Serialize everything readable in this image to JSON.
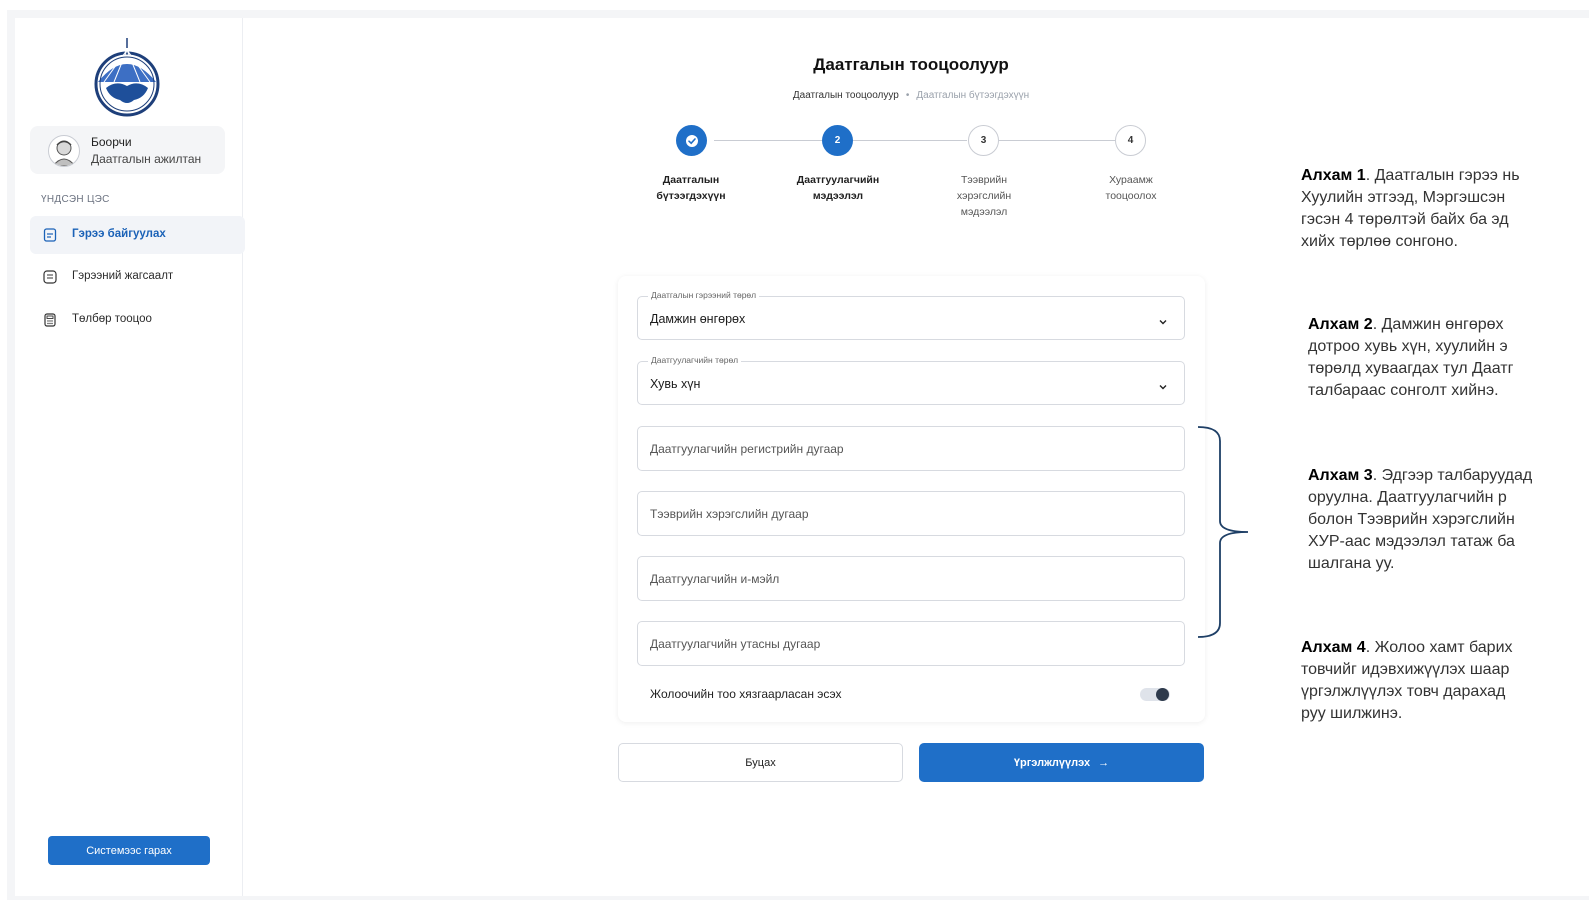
{
  "sidebar": {
    "user_name": "Боорчи",
    "user_role": "Даатгалын ажилтан",
    "section_label": "ҮНДСЭН ЦЭС",
    "items": [
      {
        "label": "Гэрээ байгуулах",
        "icon": "document-icon",
        "active": true
      },
      {
        "label": "Гэрээний жагсаалт",
        "icon": "list-icon",
        "active": false
      },
      {
        "label": "Төлбөр тооцоо",
        "icon": "calculator-icon",
        "active": false
      }
    ],
    "logout_label": "Системээс гарах"
  },
  "header": {
    "title": "Даатгалын тооцоолуур",
    "breadcrumb_current": "Даатгалын тооцоолуур",
    "breadcrumb_next": "Даатгалын бүтээгдэхүүн"
  },
  "stepper": {
    "steps": [
      {
        "number": "1",
        "label_line1": "Даатгалын",
        "label_line2": "бүтээгдэхүүн",
        "label_line3": "",
        "state": "done"
      },
      {
        "number": "2",
        "label_line1": "Даатгуулагчийн",
        "label_line2": "мэдээлэл",
        "label_line3": "",
        "state": "active"
      },
      {
        "number": "3",
        "label_line1": "Тээврийн",
        "label_line2": "хэрэгслийн",
        "label_line3": "мэдээлэл",
        "state": "todo"
      },
      {
        "number": "4",
        "label_line1": "Хураамж",
        "label_line2": "тооцоолох",
        "label_line3": "",
        "state": "todo"
      }
    ]
  },
  "form": {
    "contract_type": {
      "legend": "Даатгалын гэрээний төрөл",
      "value": "Дамжин өнгөрөх"
    },
    "insured_type": {
      "legend": "Даатгуулагчийн төрөл",
      "value": "Хувь хүн"
    },
    "register_placeholder": "Даатгуулагчийн регистрийн дугаар",
    "vehicle_placeholder": "Тээврийн хэрэгслийн дугаар",
    "email_placeholder": "Даатгуулагчийн и-мэйл",
    "phone_placeholder": "Даатгуулагчийн утасны дугаар",
    "driver_limit_label": "Жолоочийн тоо хязгаарласан эсэх",
    "back_label": "Буцах",
    "next_label": "Үргэлжлүүлэх",
    "next_arrow": "→"
  },
  "notes": [
    {
      "title": "Алхам 1",
      "text": ". Даатгалын гэрээ нь\nХуулийн этгээд, Мэргэшсэн\nгэсэн 4 төрөлтэй байх ба эд\nхийх төрлөө сонгоно."
    },
    {
      "title": "Алхам 2",
      "text": ". Дамжин өнгөрөх\nдотроо хувь хүн, хуулийн э\nтөрөлд хуваагдах тул Даатг\nталбараас сонголт хийнэ."
    },
    {
      "title": "Алхам 3",
      "text": ". Эдгээр талбаруудад\nоруулна. Даатгуулагчийн р\nболон Тээврийн хэрэгслийн\nХУР-аас мэдээлэл татаж ба\nшалгана уу."
    },
    {
      "title": "Алхам 4",
      "text": ". Жолоо хамт барих\nтовчийг идэвхижүүлэх шаар\nүргэлжлүүлэх товч дарахад\nруу шилжинэ."
    }
  ],
  "colors": {
    "accent": "#1f6fc8",
    "active_nav_text": "#1b62b7",
    "bracket": "#1e3f66"
  }
}
